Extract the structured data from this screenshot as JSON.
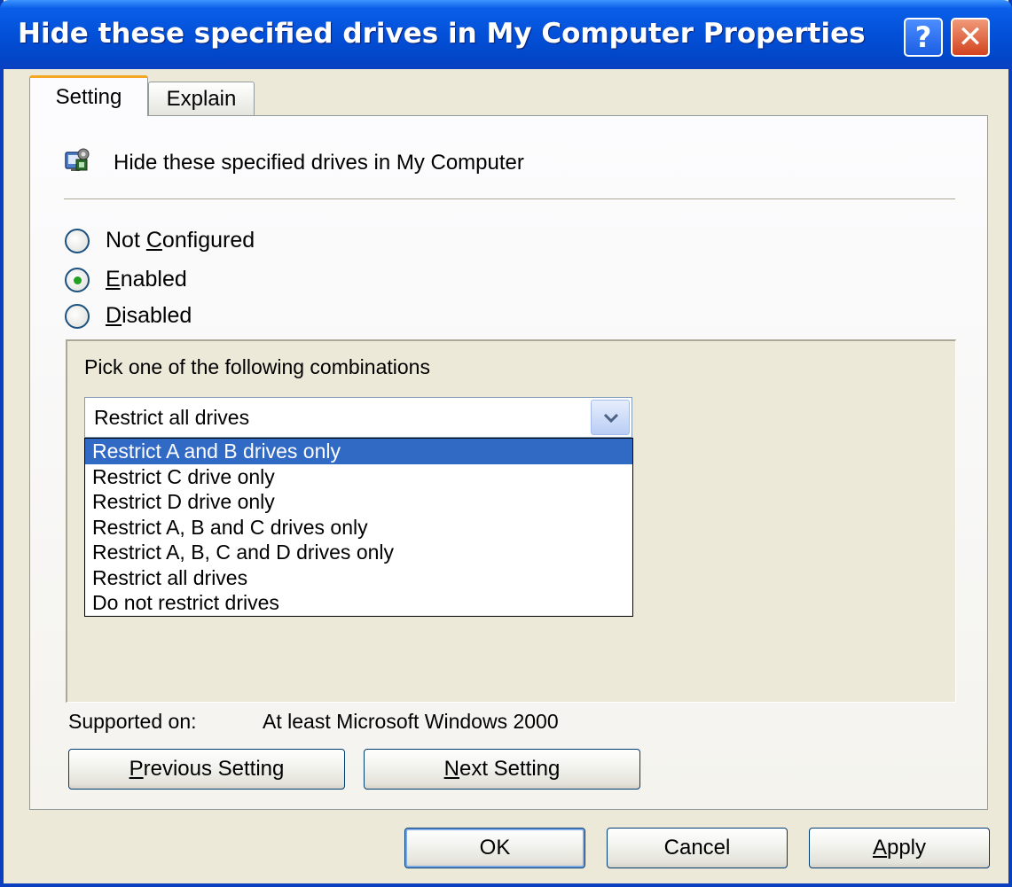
{
  "window": {
    "title": "Hide these specified drives in My Computer Properties",
    "help_symbol": "?",
    "close_symbol": "✕"
  },
  "tabs": [
    {
      "label": "Setting",
      "active": true
    },
    {
      "label": "Explain",
      "active": false
    }
  ],
  "policy": {
    "icon": "policy-setting-icon",
    "name": "Hide these specified drives in My Computer"
  },
  "radios": [
    {
      "pre": "Not ",
      "access": "C",
      "post": "onfigured",
      "checked": false
    },
    {
      "pre": "",
      "access": "E",
      "post": "nabled",
      "checked": true
    },
    {
      "pre": "",
      "access": "D",
      "post": "isabled",
      "checked": false
    }
  ],
  "options": {
    "pick_label": "Pick one of the following combinations",
    "combo_value": "Restrict all drives",
    "dropdown_items": [
      {
        "label": "Restrict A and B drives only",
        "highlighted": true
      },
      {
        "label": "Restrict C drive only",
        "highlighted": false
      },
      {
        "label": "Restrict D drive only",
        "highlighted": false
      },
      {
        "label": "Restrict A, B and C drives only",
        "highlighted": false
      },
      {
        "label": "Restrict A, B, C and D drives only",
        "highlighted": false
      },
      {
        "label": "Restrict all drives",
        "highlighted": false
      },
      {
        "label": "Do not restrict drives",
        "highlighted": false
      }
    ]
  },
  "supported": {
    "label": "Supported on:",
    "value": "At least Microsoft Windows 2000"
  },
  "nav_buttons": {
    "previous": {
      "access": "P",
      "rest": "revious Setting"
    },
    "next": {
      "access": "N",
      "rest": "ext Setting"
    }
  },
  "dialog_buttons": {
    "ok": "OK",
    "cancel": "Cancel",
    "apply": {
      "access": "A",
      "rest": "pply"
    }
  },
  "colors": {
    "titlebar": "#0350d8",
    "selection": "#316ac5",
    "active_tab_accent": "#f5a623",
    "dialog_face": "#ece9d8"
  }
}
